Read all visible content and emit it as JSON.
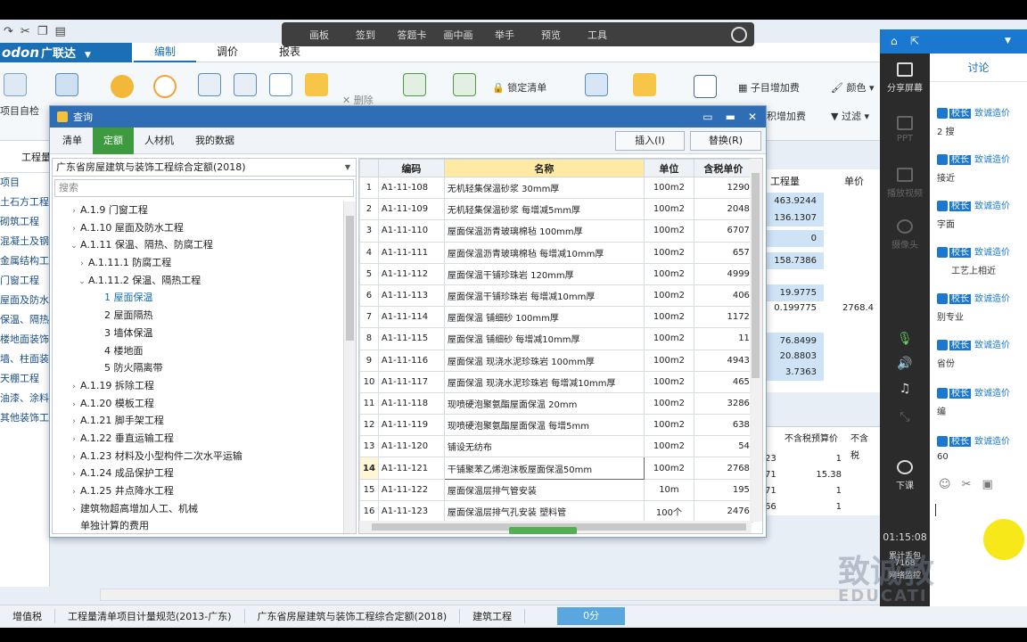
{
  "meeting_toolbar": [
    "画板",
    "签到",
    "答题卡",
    "画中画",
    "举手",
    "预览",
    "工具"
  ],
  "brand": {
    "logo": "odon",
    "cn": "广联达",
    "dropdown": "▼"
  },
  "main_tabs": [
    "编制",
    "调价",
    "报表"
  ],
  "ribbon": {
    "self_check": "项目自检",
    "lock_list": "锁定清单",
    "sub_add": "子目增加费",
    "color": "颜色",
    "measure_add": "积增加费",
    "filter": "过滤",
    "delete": "删除"
  },
  "left_panel": {
    "header": "工程量",
    "items": [
      "项目",
      "土石方工程",
      "砌筑工程",
      "混凝土及钢筋",
      "金属结构工程",
      "门窗工程",
      "屋面及防水工",
      "保温、隔热、",
      "楼地面装饰工",
      "墙、柱面装饰",
      "天棚工程",
      "油漆、涂料、",
      "其他装饰工程"
    ]
  },
  "bg_grid": {
    "headers": [
      "工程量",
      "单价"
    ],
    "values": [
      "463.9244",
      "136.1307",
      "0",
      "158.7386",
      "19.9775",
      "0.199775",
      "76.8499",
      "20.8803",
      "3.7363"
    ],
    "price_partial": "2768.4",
    "lower_headers": [
      "不含税预算价",
      "不含税"
    ],
    "lower_rows": [
      [
        "23",
        "1"
      ],
      [
        "71",
        "15.38"
      ],
      [
        "71",
        "1"
      ],
      [
        "66",
        "1"
      ]
    ]
  },
  "dialog": {
    "title": "查询",
    "tabs": [
      "清单",
      "定额",
      "人材机",
      "我的数据"
    ],
    "insert_btn": "插入(I)",
    "replace_btn": "替换(R)",
    "quota_lib": "广东省房屋建筑与装饰工程综合定额(2018)",
    "search_placeholder": "搜索",
    "tree": [
      {
        "label": "A.1.9 门窗工程",
        "indent": 1,
        "tog": "›"
      },
      {
        "label": "A.1.10 屋面及防水工程",
        "indent": 1,
        "tog": "›"
      },
      {
        "label": "A.1.11 保温、隔热、防腐工程",
        "indent": 1,
        "tog": "⌄"
      },
      {
        "label": "A.1.11.1 防腐工程",
        "indent": 2,
        "tog": "›"
      },
      {
        "label": "A.1.11.2 保温、隔热工程",
        "indent": 2,
        "tog": "⌄"
      },
      {
        "label": "1 屋面保温",
        "indent": 4,
        "tog": "",
        "sel": true
      },
      {
        "label": "2 屋面隔热",
        "indent": 4,
        "tog": ""
      },
      {
        "label": "3 墙体保温",
        "indent": 4,
        "tog": ""
      },
      {
        "label": "4 楼地面",
        "indent": 4,
        "tog": ""
      },
      {
        "label": "5 防火隔离带",
        "indent": 4,
        "tog": ""
      },
      {
        "label": "A.1.19 拆除工程",
        "indent": 1,
        "tog": "›"
      },
      {
        "label": "A.1.20 模板工程",
        "indent": 1,
        "tog": "›"
      },
      {
        "label": "A.1.21 脚手架工程",
        "indent": 1,
        "tog": "›"
      },
      {
        "label": "A.1.22 垂直运输工程",
        "indent": 1,
        "tog": "›"
      },
      {
        "label": "A.1.23 材料及小型构件二次水平运输",
        "indent": 1,
        "tog": "›"
      },
      {
        "label": "A.1.24 成品保护工程",
        "indent": 1,
        "tog": "›"
      },
      {
        "label": "A.1.25 井点降水工程",
        "indent": 1,
        "tog": "›"
      },
      {
        "label": "建筑物超高增加人工、机械",
        "indent": 1,
        "tog": "›"
      },
      {
        "label": "单独计算的费用",
        "indent": 1,
        "tog": ""
      }
    ],
    "columns": [
      "",
      "编码",
      "名称",
      "单位",
      "含税单价"
    ],
    "rows": [
      [
        "1",
        "A1-11-108",
        "无机轻集保温砂浆 30mm厚",
        "100m2",
        "1290"
      ],
      [
        "2",
        "A1-11-109",
        "无机轻集保温砂浆 每增减5mm厚",
        "100m2",
        "2048"
      ],
      [
        "3",
        "A1-11-110",
        "屋面保温沥青玻璃棉毡 100mm厚",
        "100m2",
        "6707"
      ],
      [
        "4",
        "A1-11-111",
        "屋面保温沥青玻璃棉毡 每增减10mm厚",
        "100m2",
        "657"
      ],
      [
        "5",
        "A1-11-112",
        "屋面保温干铺珍珠岩 120mm厚",
        "100m2",
        "4999"
      ],
      [
        "6",
        "A1-11-113",
        "屋面保温干铺珍珠岩 每增减10mm厚",
        "100m2",
        "406"
      ],
      [
        "7",
        "A1-11-114",
        "屋面保温 铺细砂 100mm厚",
        "100m2",
        "1172"
      ],
      [
        "8",
        "A1-11-115",
        "屋面保温 铺细砂 每增减10mm厚",
        "100m2",
        "11"
      ],
      [
        "9",
        "A1-11-116",
        "屋面保温 现浇水泥珍珠岩 100mm厚",
        "100m2",
        "4943"
      ],
      [
        "10",
        "A1-11-117",
        "屋面保温 现浇水泥珍珠岩 每增减10mm厚",
        "100m2",
        "465"
      ],
      [
        "11",
        "A1-11-118",
        "现喷硬泡聚氨酯屋面保温 20mm",
        "100m2",
        "3286"
      ],
      [
        "12",
        "A1-11-119",
        "现喷硬泡聚氨酯屋面保温 每增5mm",
        "100m2",
        "638"
      ],
      [
        "13",
        "A1-11-120",
        "铺设无纺布",
        "100m2",
        "54"
      ],
      [
        "14",
        "A1-11-121",
        "干铺聚苯乙烯泡沫板屋面保温50mm",
        "100m2",
        "2768"
      ],
      [
        "15",
        "A1-11-122",
        "屋面保温层排气管安装",
        "10m",
        "195"
      ],
      [
        "16",
        "A1-11-123",
        "屋面保温层排气孔安装 塑料管",
        "100个",
        "2476"
      ]
    ]
  },
  "statusbar": {
    "tax": "增值税",
    "norm": "工程量清单项目计量规范(2013-广东)",
    "quota": "广东省房屋建筑与装饰工程综合定额(2018)",
    "type": "建筑工程",
    "score": "0分"
  },
  "side": {
    "share": "分享屏幕",
    "ppt": "PPT",
    "video": "播放视频",
    "camera": "摄像头",
    "end": "下课",
    "time": "01:15:08",
    "loss": "累计丢包",
    "loss_val": "7168",
    "net": "网络监控"
  },
  "chat": {
    "title": "讨论",
    "role": "校长",
    "who": "致诚造价",
    "messages": [
      "2 搜",
      "接近",
      "字面",
      "工艺上相近",
      "别专业",
      "省份",
      "编",
      "60"
    ]
  },
  "watermark": "致诚教",
  "watermark_sub": "EDUCATI"
}
